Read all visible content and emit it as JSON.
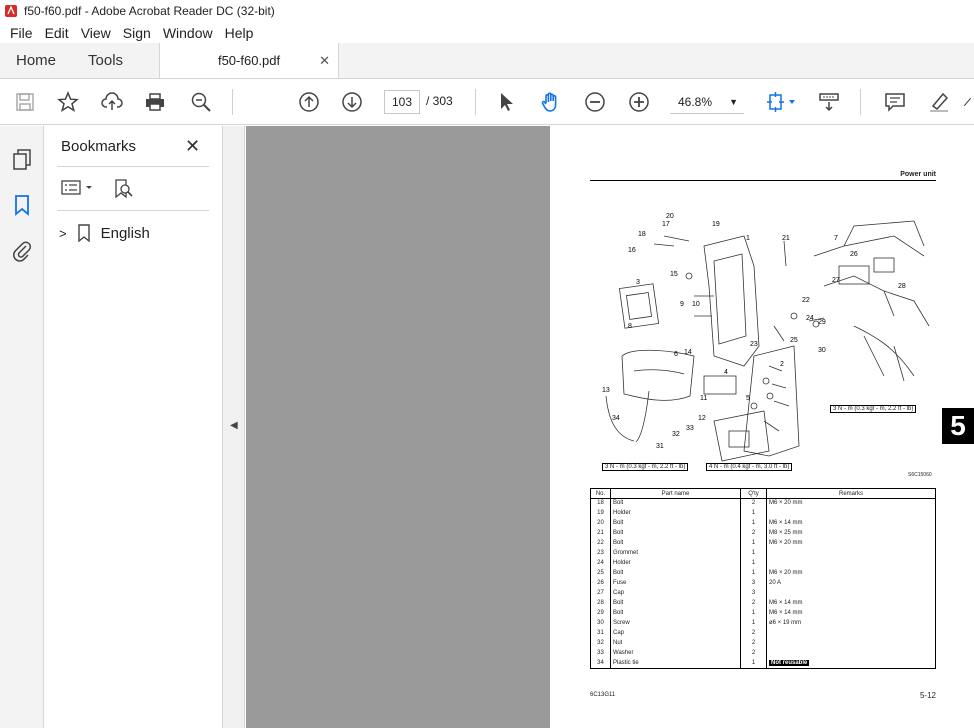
{
  "window": {
    "title": "f50-f60.pdf - Adobe Acrobat Reader DC (32-bit)"
  },
  "menu": [
    "File",
    "Edit",
    "View",
    "Sign",
    "Window",
    "Help"
  ],
  "tabs": {
    "home": "Home",
    "tools": "Tools",
    "document": "f50-f60.pdf"
  },
  "toolbar": {
    "current_page": "103",
    "total_pages": "/ 303",
    "zoom": "46.8%"
  },
  "bookmarks": {
    "title": "Bookmarks",
    "items": [
      {
        "label": "English"
      }
    ]
  },
  "document": {
    "header": "Power unit",
    "section_tab": "5",
    "drawing_code": "S6C15060",
    "torque_labels": [
      "3 N - m (0.3 kgf - m, 2.2 ft - lb)",
      "3 N - m (0.3 kgf - m, 2.2 ft - lb)",
      "4 N - m (0.4 kgf - m, 3.0 ft - lb)"
    ],
    "callouts": [
      "1",
      "2",
      "3",
      "4",
      "5",
      "6",
      "7",
      "8",
      "9",
      "10",
      "11",
      "12",
      "13",
      "14",
      "15",
      "16",
      "17",
      "18",
      "19",
      "20",
      "21",
      "22",
      "23",
      "24",
      "25",
      "26",
      "27",
      "28",
      "29",
      "30",
      "31",
      "32",
      "33",
      "34"
    ],
    "table": {
      "headers": [
        "No.",
        "Part name",
        "Q'ty",
        "Remarks"
      ],
      "rows": [
        {
          "no": "18",
          "name": "Bolt",
          "qty": "2",
          "remarks": "M6 × 20 mm"
        },
        {
          "no": "19",
          "name": "Holder",
          "qty": "1",
          "remarks": ""
        },
        {
          "no": "20",
          "name": "Bolt",
          "qty": "1",
          "remarks": "M6 × 14 mm"
        },
        {
          "no": "21",
          "name": "Bolt",
          "qty": "2",
          "remarks": "M8 × 25 mm"
        },
        {
          "no": "22",
          "name": "Bolt",
          "qty": "1",
          "remarks": "M6 × 20 mm"
        },
        {
          "no": "23",
          "name": "Grommet",
          "qty": "1",
          "remarks": ""
        },
        {
          "no": "24",
          "name": "Holder",
          "qty": "1",
          "remarks": ""
        },
        {
          "no": "25",
          "name": "Bolt",
          "qty": "1",
          "remarks": "M6 × 20 mm"
        },
        {
          "no": "26",
          "name": "Fuse",
          "qty": "3",
          "remarks": "20 A"
        },
        {
          "no": "27",
          "name": "Cap",
          "qty": "3",
          "remarks": ""
        },
        {
          "no": "28",
          "name": "Bolt",
          "qty": "2",
          "remarks": "M6 × 14 mm"
        },
        {
          "no": "29",
          "name": "Bolt",
          "qty": "1",
          "remarks": "M6 × 14 mm"
        },
        {
          "no": "30",
          "name": "Screw",
          "qty": "1",
          "remarks": "ø6 × 19 mm"
        },
        {
          "no": "31",
          "name": "Cap",
          "qty": "2",
          "remarks": ""
        },
        {
          "no": "32",
          "name": "Nut",
          "qty": "2",
          "remarks": ""
        },
        {
          "no": "33",
          "name": "Washer",
          "qty": "2",
          "remarks": ""
        },
        {
          "no": "34",
          "name": "Plastic tie",
          "qty": "1",
          "remarks": "",
          "badge": "Not reusable"
        }
      ]
    },
    "footer_left": "6C13G11",
    "footer_right": "5-12"
  }
}
